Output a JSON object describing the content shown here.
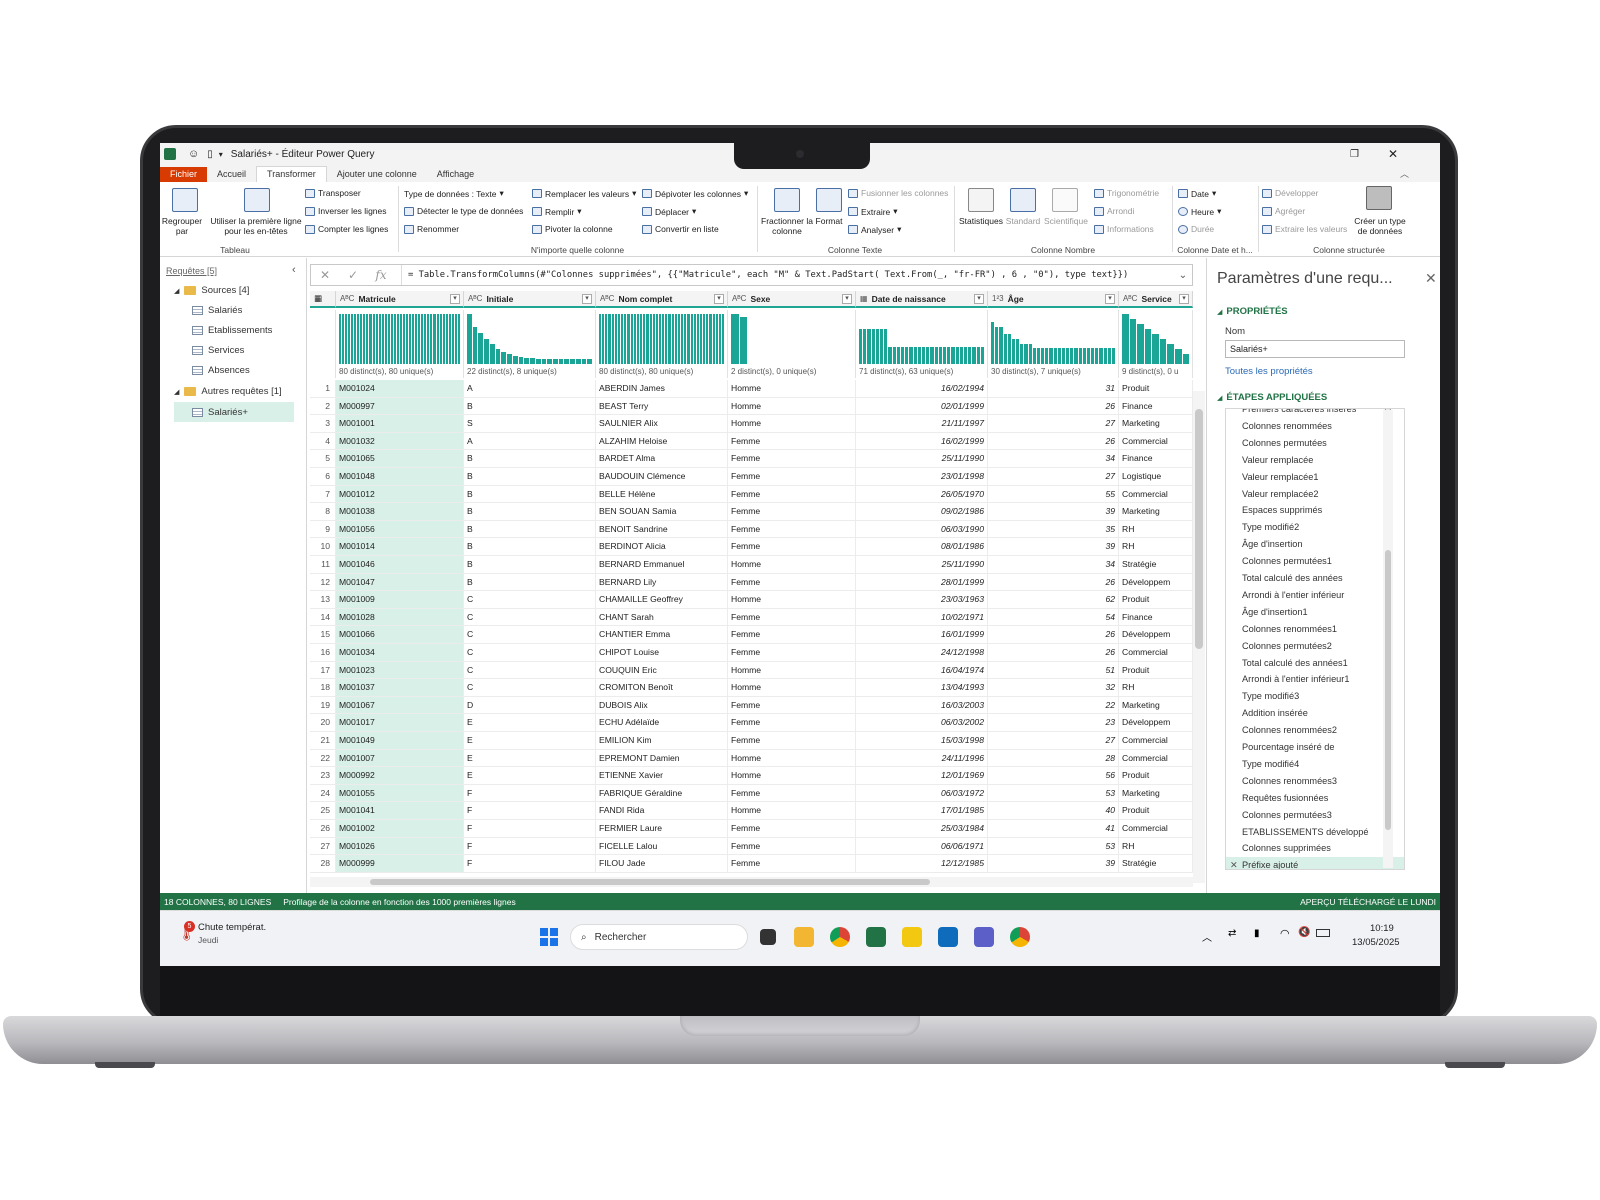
{
  "window": {
    "title": "Salariés+ - Éditeur Power Query"
  },
  "ribbon": {
    "tabs": [
      "Fichier",
      "Accueil",
      "Transformer",
      "Ajouter une colonne",
      "Affichage"
    ],
    "active_tab": "Transformer",
    "groups": {
      "tableau": {
        "label": "Tableau",
        "regrouper": "Regrouper par",
        "premiere_ligne": "Utiliser la première ligne pour les en-têtes",
        "transposer": "Transposer",
        "inverser": "Inverser les lignes",
        "compter": "Compter les lignes"
      },
      "nimporte": {
        "label": "N'importe quelle colonne",
        "type_donnees": "Type de données : Texte",
        "detecter": "Détecter le type de données",
        "renommer": "Renommer",
        "remplacer": "Remplacer les valeurs",
        "remplir": "Remplir",
        "pivoter": "Pivoter la colonne",
        "depivoter": "Dépivoter les colonnes",
        "deplacer": "Déplacer",
        "convertir": "Convertir en liste"
      },
      "texte": {
        "label": "Colonne Texte",
        "fractionner": "Fractionner la colonne",
        "format": "Format",
        "fusionner": "Fusionner les colonnes",
        "extraire": "Extraire",
        "analyser": "Analyser"
      },
      "nombre": {
        "label": "Colonne Nombre",
        "statistiques": "Statistiques",
        "standard": "Standard",
        "scientifique": "Scientifique",
        "trigo": "Trigonométrie",
        "arrondi": "Arrondi",
        "informations": "Informations"
      },
      "date": {
        "label": "Colonne Date et h...",
        "date": "Date",
        "heure": "Heure",
        "duree": "Durée"
      },
      "structuree": {
        "label": "Colonne structurée",
        "developper": "Développer",
        "agreger": "Agréger",
        "extraire_valeurs": "Extraire les valeurs",
        "creer_type": "Créer un type de données"
      }
    }
  },
  "queries": {
    "header": "Requêtes [5]",
    "sources_folder": "Sources [4]",
    "sources": [
      "Salariés",
      "Etablissements",
      "Services",
      "Absences"
    ],
    "other_folder": "Autres requêtes [1]",
    "selected": "Salariés+"
  },
  "formula": "= Table.TransformColumns(#\"Colonnes supprimées\", {{\"Matricule\", each \"M\" & Text.PadStart( Text.From(_, \"fr-FR\") , 6 , \"0\"), type text}})",
  "columns": [
    {
      "name": "Matricule",
      "type": "ABC",
      "profile": "80 distinct(s), 80 unique(s)"
    },
    {
      "name": "Initiale",
      "type": "ABC",
      "profile": "22 distinct(s), 8 unique(s)"
    },
    {
      "name": "Nom complet",
      "type": "ABC",
      "profile": "80 distinct(s), 80 unique(s)"
    },
    {
      "name": "Sexe",
      "type": "ABC",
      "profile": "2 distinct(s), 0 unique(s)"
    },
    {
      "name": "Date de naissance",
      "type": "date",
      "profile": "71 distinct(s), 63 unique(s)"
    },
    {
      "name": "Âge",
      "type": "123",
      "profile": "30 distinct(s), 7 unique(s)"
    },
    {
      "name": "Service",
      "type": "ABC",
      "profile": "9 distinct(s), 0 u"
    }
  ],
  "rows": [
    [
      "1",
      "M001024",
      "A",
      "ABERDIN James",
      "Homme",
      "16/02/1994",
      "31",
      "Produit"
    ],
    [
      "2",
      "M000997",
      "B",
      "BEAST Terry",
      "Homme",
      "02/01/1999",
      "26",
      "Finance"
    ],
    [
      "3",
      "M001001",
      "S",
      "SAULNIER Alix",
      "Homme",
      "21/11/1997",
      "27",
      "Marketing"
    ],
    [
      "4",
      "M001032",
      "A",
      "ALZAHIM Heloise",
      "Femme",
      "16/02/1999",
      "26",
      "Commercial"
    ],
    [
      "5",
      "M001065",
      "B",
      "BARDET Alma",
      "Femme",
      "25/11/1990",
      "34",
      "Finance"
    ],
    [
      "6",
      "M001048",
      "B",
      "BAUDOUIN Clémence",
      "Femme",
      "23/01/1998",
      "27",
      "Logistique"
    ],
    [
      "7",
      "M001012",
      "B",
      "BELLE Hélène",
      "Femme",
      "26/05/1970",
      "55",
      "Commercial"
    ],
    [
      "8",
      "M001038",
      "B",
      "BEN SOUAN Samia",
      "Femme",
      "09/02/1986",
      "39",
      "Marketing"
    ],
    [
      "9",
      "M001056",
      "B",
      "BENOIT Sandrine",
      "Femme",
      "06/03/1990",
      "35",
      "RH"
    ],
    [
      "10",
      "M001014",
      "B",
      "BERDINOT Alicia",
      "Femme",
      "08/01/1986",
      "39",
      "RH"
    ],
    [
      "11",
      "M001046",
      "B",
      "BERNARD Emmanuel",
      "Homme",
      "25/11/1990",
      "34",
      "Stratégie"
    ],
    [
      "12",
      "M001047",
      "B",
      "BERNARD Lily",
      "Femme",
      "28/01/1999",
      "26",
      "Développem"
    ],
    [
      "13",
      "M001009",
      "C",
      "CHAMAILLE Geoffrey",
      "Homme",
      "23/03/1963",
      "62",
      "Produit"
    ],
    [
      "14",
      "M001028",
      "C",
      "CHANT Sarah",
      "Femme",
      "10/02/1971",
      "54",
      "Finance"
    ],
    [
      "15",
      "M001066",
      "C",
      "CHANTIER Emma",
      "Femme",
      "16/01/1999",
      "26",
      "Développem"
    ],
    [
      "16",
      "M001034",
      "C",
      "CHIPOT Louise",
      "Femme",
      "24/12/1998",
      "26",
      "Commercial"
    ],
    [
      "17",
      "M001023",
      "C",
      "COUQUIN Eric",
      "Homme",
      "16/04/1974",
      "51",
      "Produit"
    ],
    [
      "18",
      "M001037",
      "C",
      "CROMITON Benoît",
      "Homme",
      "13/04/1993",
      "32",
      "RH"
    ],
    [
      "19",
      "M001067",
      "D",
      "DUBOIS Alix",
      "Femme",
      "16/03/2003",
      "22",
      "Marketing"
    ],
    [
      "20",
      "M001017",
      "E",
      "ECHU Adélaïde",
      "Femme",
      "06/03/2002",
      "23",
      "Développem"
    ],
    [
      "21",
      "M001049",
      "E",
      "EMILION Kim",
      "Femme",
      "15/03/1998",
      "27",
      "Commercial"
    ],
    [
      "22",
      "M001007",
      "E",
      "EPREMONT Damien",
      "Homme",
      "24/11/1996",
      "28",
      "Commercial"
    ],
    [
      "23",
      "M000992",
      "E",
      "ETIENNE Xavier",
      "Homme",
      "12/01/1969",
      "56",
      "Produit"
    ],
    [
      "24",
      "M001055",
      "F",
      "FABRIQUE Géraldine",
      "Femme",
      "06/03/1972",
      "53",
      "Marketing"
    ],
    [
      "25",
      "M001041",
      "F",
      "FANDI Rida",
      "Homme",
      "17/01/1985",
      "40",
      "Produit"
    ],
    [
      "26",
      "M001002",
      "F",
      "FERMIER Laure",
      "Femme",
      "25/03/1984",
      "41",
      "Commercial"
    ],
    [
      "27",
      "M001026",
      "F",
      "FICELLE Lalou",
      "Femme",
      "06/06/1971",
      "53",
      "RH"
    ],
    [
      "28",
      "M000999",
      "F",
      "FILOU Jade",
      "Femme",
      "12/12/1985",
      "39",
      "Stratégie"
    ]
  ],
  "settings": {
    "title": "Paramètres d'une requ...",
    "properties_label": "PROPRIÉTÉS",
    "name_label": "Nom",
    "name_value": "Salariés+",
    "all_properties": "Toutes les propriétés",
    "steps_label": "ÉTAPES APPLIQUÉES",
    "steps": [
      {
        "name": "Premiers caractères insérés",
        "gear": true
      },
      {
        "name": "Colonnes renommées",
        "gear": false
      },
      {
        "name": "Colonnes permutées",
        "gear": false
      },
      {
        "name": "Valeur remplacée",
        "gear": true
      },
      {
        "name": "Valeur remplacée1",
        "gear": true
      },
      {
        "name": "Valeur remplacée2",
        "gear": true
      },
      {
        "name": "Espaces supprimés",
        "gear": false
      },
      {
        "name": "Type modifié2",
        "gear": false
      },
      {
        "name": "Âge d'insertion",
        "gear": true
      },
      {
        "name": "Colonnes permutées1",
        "gear": false
      },
      {
        "name": "Total calculé des années",
        "gear": false
      },
      {
        "name": "Arrondi à l'entier inférieur",
        "gear": false
      },
      {
        "name": "Âge d'insertion1",
        "gear": true
      },
      {
        "name": "Colonnes renommées1",
        "gear": false
      },
      {
        "name": "Colonnes permutées2",
        "gear": false
      },
      {
        "name": "Total calculé des années1",
        "gear": false
      },
      {
        "name": "Arrondi à l'entier inférieur1",
        "gear": false
      },
      {
        "name": "Type modifié3",
        "gear": false
      },
      {
        "name": "Addition insérée",
        "gear": true
      },
      {
        "name": "Colonnes renommées2",
        "gear": false
      },
      {
        "name": "Pourcentage inséré de",
        "gear": true
      },
      {
        "name": "Type modifié4",
        "gear": false
      },
      {
        "name": "Colonnes renommées3",
        "gear": false
      },
      {
        "name": "Requêtes fusionnées",
        "gear": true
      },
      {
        "name": "Colonnes permutées3",
        "gear": false
      },
      {
        "name": "ETABLISSEMENTS développé",
        "gear": true
      },
      {
        "name": "Colonnes supprimées",
        "gear": false
      },
      {
        "name": "Préfixe ajouté",
        "gear": false,
        "current": true
      }
    ]
  },
  "status": {
    "left": "18 COLONNES, 80 LIGNES",
    "profiling": "Profilage de la colonne en fonction des 1000 premières lignes",
    "right": "APERÇU TÉLÉCHARGÉ LE LUNDI"
  },
  "taskbar": {
    "weather": "Chute températ.",
    "weather_sub": "Jeudi",
    "weather_badge": "5",
    "search": "Rechercher",
    "time": "10:19",
    "date": "13/05/2025"
  },
  "colors": {
    "accent": "#1ba597",
    "status_green": "#217346",
    "file_tab": "#d83b01"
  }
}
